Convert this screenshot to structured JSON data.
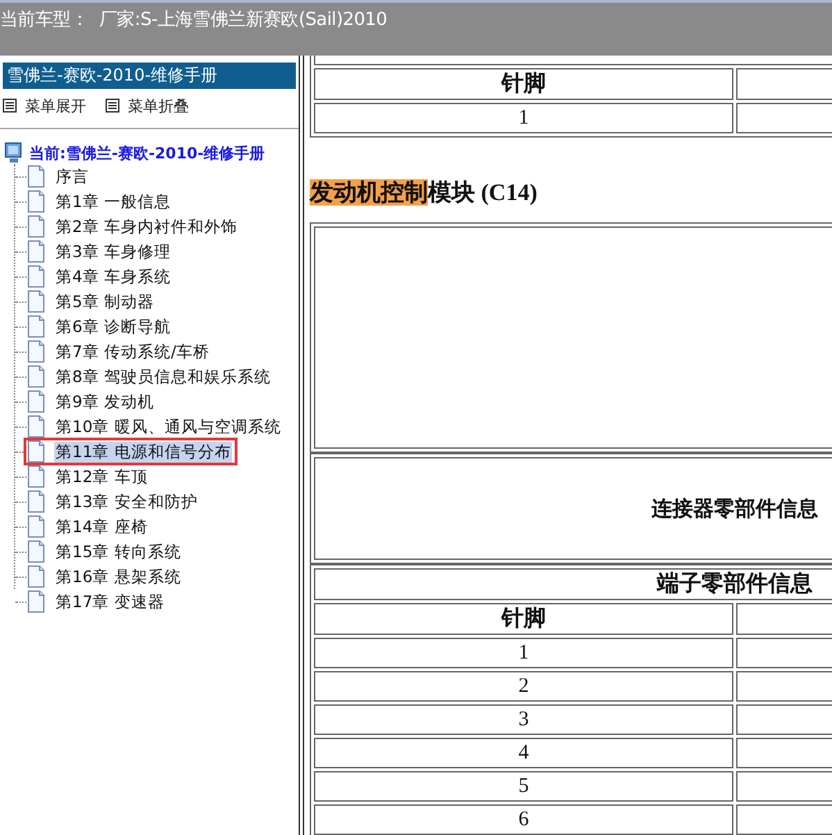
{
  "header": {
    "label": "当前车型：",
    "value": "厂家:S-上海雪佛兰新赛欧(Sail)2010"
  },
  "sidebar": {
    "title": "雪佛兰-赛欧-2010-维修手册",
    "actions": [
      "菜单展开",
      "菜单折叠"
    ],
    "tree": {
      "label": "当前:雪佛兰-赛欧-2010-维修手册",
      "children": [
        {
          "label": "序言",
          "selected": false
        },
        {
          "label": "第1章 一般信息",
          "selected": false
        },
        {
          "label": "第2章 车身内衬件和外饰",
          "selected": false
        },
        {
          "label": "第3章 车身修理",
          "selected": false
        },
        {
          "label": "第4章 车身系统",
          "selected": false
        },
        {
          "label": "第5章 制动器",
          "selected": false
        },
        {
          "label": "第6章 诊断导航",
          "selected": false
        },
        {
          "label": "第7章 传动系统/车桥",
          "selected": false
        },
        {
          "label": "第8章 驾驶员信息和娱乐系统",
          "selected": false
        },
        {
          "label": "第9章 发动机",
          "selected": false
        },
        {
          "label": "第10章 暖风、通风与空调系统",
          "selected": false
        },
        {
          "label": "第11章 电源和信号分布",
          "selected": true
        },
        {
          "label": "第12章 车顶",
          "selected": false
        },
        {
          "label": "第13章 安全和防护",
          "selected": false
        },
        {
          "label": "第14章 座椅",
          "selected": false
        },
        {
          "label": "第15章 转向系统",
          "selected": false
        },
        {
          "label": "第16章 悬架系统",
          "selected": false
        },
        {
          "label": "第17章 变速器",
          "selected": false
        }
      ]
    }
  },
  "content": {
    "top_table": {
      "pin_header": "针脚",
      "pins": [
        "1"
      ]
    },
    "title": [
      {
        "text": "发动机控制",
        "highlighted": true
      },
      {
        "text": "模块 (C14)",
        "highlighted": false
      }
    ],
    "connector_info": "连接器零部件信息",
    "terminal_info": "端子零部件信息",
    "pin_table": {
      "pin_header": "针脚",
      "pins": [
        "1",
        "2",
        "3",
        "4",
        "5",
        "6"
      ]
    }
  }
}
